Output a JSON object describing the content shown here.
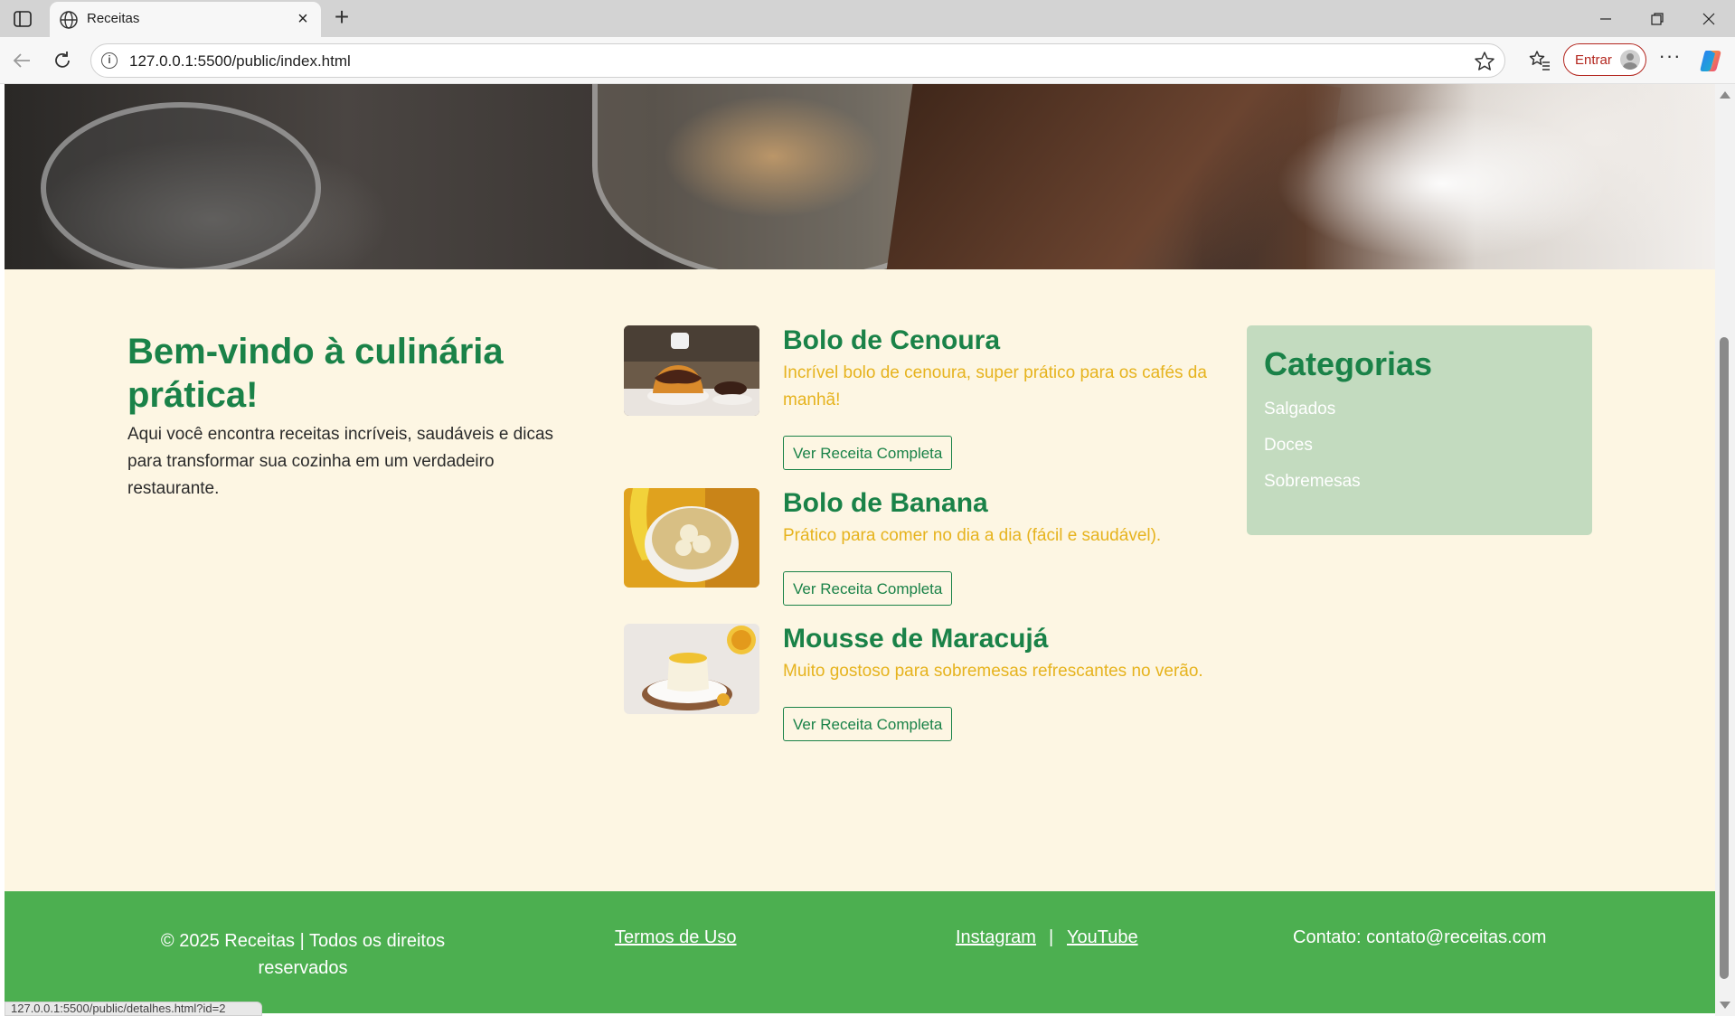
{
  "browser": {
    "tab_title": "Receitas",
    "url": "127.0.0.1:5500/public/index.html",
    "signin_label": "Entrar",
    "more_label": "···",
    "new_tab_label": "+",
    "close_tab_label": "×",
    "status_url": "127.0.0.1:5500/public/detalhes.html?id=2"
  },
  "welcome": {
    "title": "Bem-vindo à culinária prática!",
    "text": "Aqui você encontra receitas incríveis, saudáveis e dicas para transformar sua cozinha em um verdadeiro restaurante."
  },
  "recipes": [
    {
      "title": "Bolo de Cenoura",
      "description": "Incrível bolo de cenoura, super prático para os cafés da manhã!",
      "button": "Ver Receita Completa"
    },
    {
      "title": "Bolo de Banana",
      "description": "Prático para comer no dia a dia (fácil e saudável).",
      "button": "Ver Receita Completa"
    },
    {
      "title": "Mousse de Maracujá",
      "description": "Muito gostoso para sobremesas refrescantes no verão.",
      "button": "Ver Receita Completa"
    }
  ],
  "categories": {
    "title": "Categorias",
    "items": [
      "Salgados",
      "Doces",
      "Sobremesas"
    ]
  },
  "footer": {
    "copyright": "© 2025 Receitas | Todos os direitos reservados",
    "terms": "Termos de Uso",
    "instagram": "Instagram",
    "separator": "|",
    "youtube": "YouTube",
    "contact": "Contato: contato@receitas.com"
  },
  "colors": {
    "primary_green": "#1a8248",
    "accent_yellow": "#e6b31e",
    "page_background": "#fdf6e3",
    "sidebar_background": "#c3dbbf",
    "footer_background": "#4caf50"
  },
  "icons": [
    "sidebar-toggle-icon",
    "globe-icon",
    "close-icon",
    "plus-icon",
    "minimize-icon",
    "restore-icon",
    "window-close-icon",
    "back-arrow-icon",
    "reload-icon",
    "info-icon",
    "star-icon",
    "favorites-icon",
    "profile-icon",
    "more-icon",
    "copilot-icon"
  ]
}
